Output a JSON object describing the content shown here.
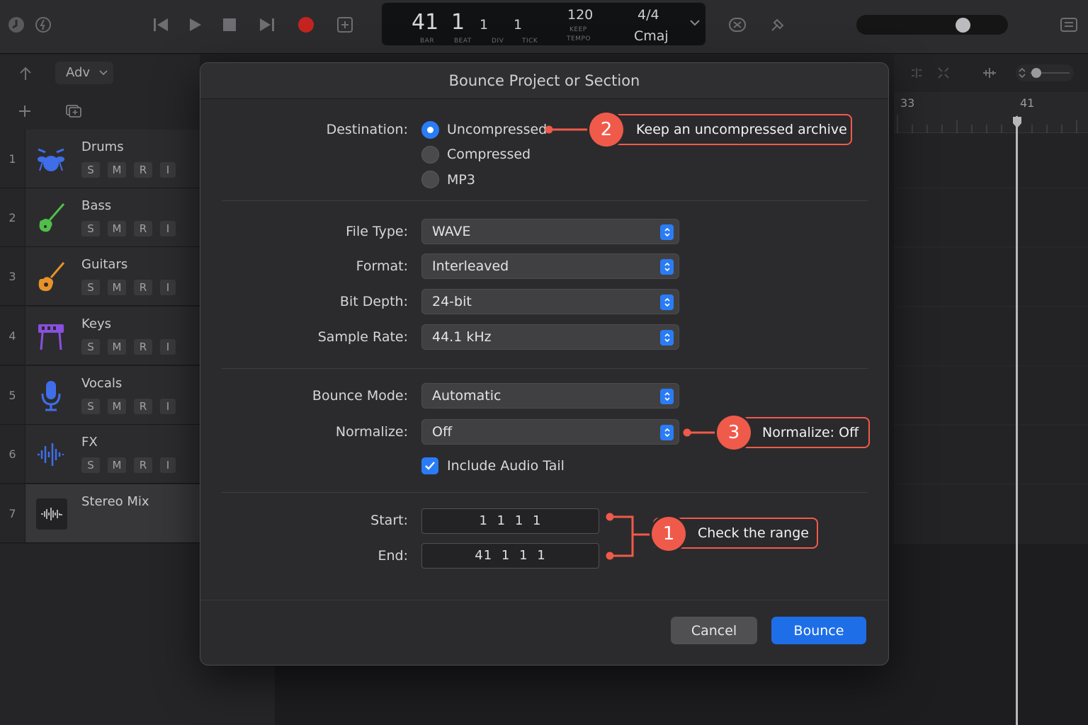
{
  "transport": {
    "bar": "41",
    "beat": "1",
    "div": "1",
    "tick": "1",
    "bar_label": "BAR",
    "beat_label": "BEAT",
    "div_label": "DIV",
    "tick_label": "TICK",
    "tempo": "120",
    "tempo_mode": "KEEP",
    "tempo_label": "TEMPO",
    "time_signature": "4/4",
    "key": "Cmaj"
  },
  "tracks_header": {
    "view_menu": "Adv"
  },
  "tracks": [
    {
      "number": "1",
      "name": "Drums",
      "icon": "drums-icon",
      "color": "#3f6ee8",
      "solo": "S",
      "mute": "M",
      "record": "R",
      "input": "I"
    },
    {
      "number": "2",
      "name": "Bass",
      "icon": "bass-guitar-icon",
      "color": "#4fbf4a",
      "solo": "S",
      "mute": "M",
      "record": "R",
      "input": "I"
    },
    {
      "number": "3",
      "name": "Guitars",
      "icon": "guitar-icon",
      "color": "#e8922a",
      "solo": "S",
      "mute": "M",
      "record": "R",
      "input": "I"
    },
    {
      "number": "4",
      "name": "Keys",
      "icon": "keyboard-icon",
      "color": "#8a4fe0",
      "solo": "S",
      "mute": "M",
      "record": "R",
      "input": "I"
    },
    {
      "number": "5",
      "name": "Vocals",
      "icon": "microphone-icon",
      "color": "#3f6ee8",
      "solo": "S",
      "mute": "M",
      "record": "R",
      "input": "I"
    },
    {
      "number": "6",
      "name": "FX",
      "icon": "waveform-icon",
      "color": "#3f6ee8",
      "solo": "S",
      "mute": "M",
      "record": "R",
      "input": "I"
    },
    {
      "number": "7",
      "name": "Stereo Mix",
      "icon": "audio-waveform-icon",
      "color": "#c0c0c2"
    }
  ],
  "ruler": {
    "marker_1": "33",
    "marker_2": "41"
  },
  "dialog": {
    "title": "Bounce Project or Section",
    "destination_label": "Destination:",
    "destinations": [
      "Uncompressed",
      "Compressed",
      "MP3"
    ],
    "selected_destination": "Uncompressed",
    "file_type_label": "File Type:",
    "file_type": "WAVE",
    "format_label": "Format:",
    "format": "Interleaved",
    "bit_depth_label": "Bit Depth:",
    "bit_depth": "24-bit",
    "sample_rate_label": "Sample Rate:",
    "sample_rate": "44.1 kHz",
    "bounce_mode_label": "Bounce Mode:",
    "bounce_mode": "Automatic",
    "normalize_label": "Normalize:",
    "normalize": "Off",
    "include_tail_label": "Include Audio Tail",
    "include_tail_checked": true,
    "start_label": "Start:",
    "start": "1 1 1 1",
    "end_label": "End:",
    "end": "41 1 1 1",
    "cancel": "Cancel",
    "bounce": "Bounce"
  },
  "callouts": [
    {
      "number": "1",
      "text": "Check the range"
    },
    {
      "number": "2",
      "text": "Keep an uncompressed archive"
    },
    {
      "number": "3",
      "text": "Normalize: Off"
    }
  ],
  "colors": {
    "accent": "#2a7cf6",
    "callout": "#f05a4a",
    "record": "#c4241f"
  }
}
